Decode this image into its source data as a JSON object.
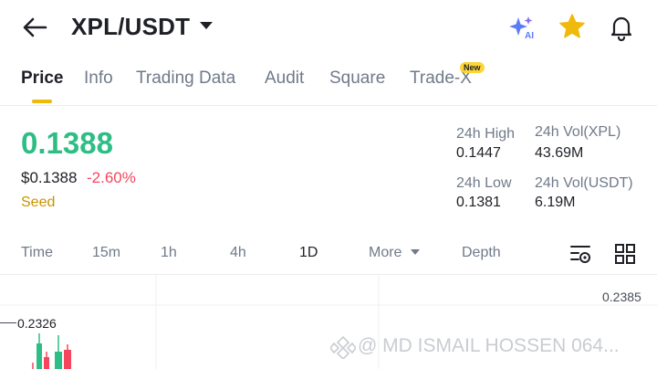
{
  "header": {
    "pair": "XPL/USDT",
    "icons": [
      "back-arrow-icon",
      "ai-sparkle-icon",
      "star-icon",
      "bell-icon"
    ],
    "favorite_color": "#f0b90b"
  },
  "tabs": [
    {
      "label": "Price",
      "active": true
    },
    {
      "label": "Info"
    },
    {
      "label": "Trading Data"
    },
    {
      "label": "Audit"
    },
    {
      "label": "Square"
    },
    {
      "label": "Trade-X",
      "badge": "New"
    }
  ],
  "price": {
    "last": "0.1388",
    "usd": "$0.1388",
    "change": "-2.60%",
    "tag": "Seed",
    "up_color": "#2ebd85",
    "down_color": "#f6465d"
  },
  "stats": {
    "high_label": "24h High",
    "high_value": "0.1447",
    "vol_base_label": "24h Vol(XPL)",
    "vol_base_value": "43.69M",
    "low_label": "24h Low",
    "low_value": "0.1381",
    "vol_quote_label": "24h Vol(USDT)",
    "vol_quote_value": "6.19M"
  },
  "timebar": {
    "time": "Time",
    "m15": "15m",
    "h1": "1h",
    "h4": "4h",
    "d1": "1D",
    "more": "More",
    "depth": "Depth",
    "active": "1D"
  },
  "chart": {
    "high_marker": "0.2385",
    "low_marker": "0.2326",
    "watermark": "@ MD ISMAIL HOSSEN 064..."
  }
}
